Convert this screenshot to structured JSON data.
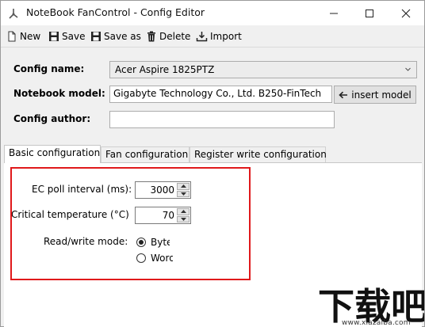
{
  "window": {
    "title": "NoteBook FanControl - Config Editor"
  },
  "toolbar": {
    "new_label": "New",
    "save_label": "Save",
    "save_as_label": "Save as",
    "delete_label": "Delete",
    "import_label": "Import"
  },
  "form": {
    "config_name_label": "Config name:",
    "config_name_value": "Acer Aspire 1825PTZ",
    "notebook_model_label": "Notebook model:",
    "notebook_model_value": "Gigabyte Technology Co., Ltd. B250-FinTech",
    "insert_model_label": "insert model",
    "config_author_label": "Config author:",
    "config_author_value": ""
  },
  "tabs": [
    {
      "label": "Basic configuration",
      "active": true
    },
    {
      "label": "Fan configuration",
      "active": false
    },
    {
      "label": "Register write configuration",
      "active": false
    }
  ],
  "basic": {
    "ec_poll_label": "EC poll interval (ms):",
    "ec_poll_value": "3000",
    "critical_temp_label": "Critical temperature (°C):",
    "critical_temp_value": "70",
    "rw_mode_label": "Read/write mode:",
    "rw_options": [
      {
        "label": "Byte",
        "checked": true
      },
      {
        "label": "Word",
        "checked": false
      }
    ]
  },
  "watermark": {
    "text": "下载吧",
    "url": "www.xiazaiba.com"
  },
  "colors": {
    "highlight": "#e0191b",
    "window_bg": "#f0f0f0"
  }
}
